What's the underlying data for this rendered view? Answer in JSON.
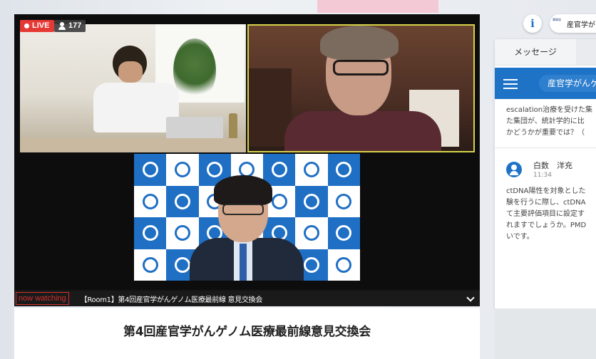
{
  "player": {
    "live_label": "LIVE",
    "viewer_count": "177",
    "caption_tag": "now watching",
    "caption_title": "【Room1】第4回産官学がんゲノム医療最前線 意見交換会"
  },
  "event": {
    "title": "第4回産官学がんゲノム医療最前線意見交換会"
  },
  "side": {
    "org_name": "産官学がんゲ",
    "org_logo_text": "事務局"
  },
  "chat": {
    "tabs": [
      "メッセージ",
      ""
    ],
    "room_name": "産官学がんゲノム",
    "prev_message_lines": [
      "escalation治療を受けた集",
      "た集団が、統計学的に比",
      "かどうかが重要では？（"
    ],
    "message": {
      "author": "白数　洋充",
      "time": "11:34",
      "lines": [
        "ctDNA陽性を対象とした",
        "験を行うに際し、ctDNA",
        "て主要評価項目に設定す",
        "れますでしょうか。PMD",
        "いです。"
      ]
    }
  },
  "colors": {
    "live_red": "#e53935",
    "brand_blue": "#1e73c7",
    "speaker_highlight": "#d7d24a"
  }
}
